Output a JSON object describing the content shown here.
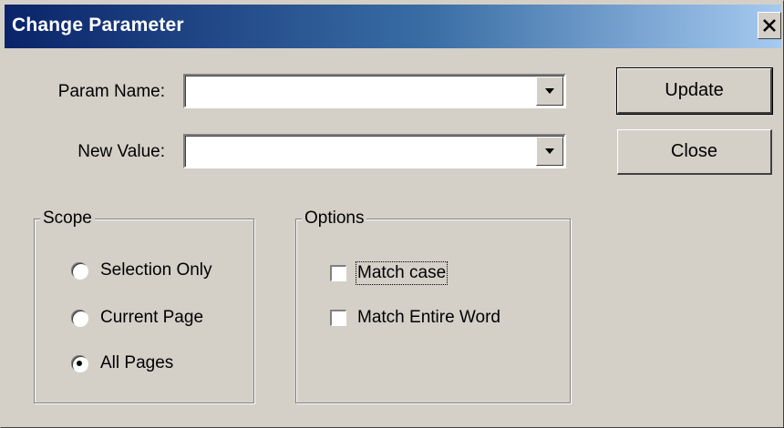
{
  "window": {
    "title": "Change Parameter"
  },
  "fields": {
    "param_name": {
      "label": "Param Name:",
      "value": ""
    },
    "new_value": {
      "label": "New Value:",
      "value": ""
    }
  },
  "buttons": {
    "update": "Update",
    "close": "Close"
  },
  "scope": {
    "title": "Scope",
    "options": [
      "Selection Only",
      "Current Page",
      "All Pages"
    ],
    "selected": "All Pages"
  },
  "options": {
    "title": "Options",
    "items": [
      {
        "label": "Match case",
        "checked": false
      },
      {
        "label": "Match Entire Word",
        "checked": false
      }
    ]
  }
}
